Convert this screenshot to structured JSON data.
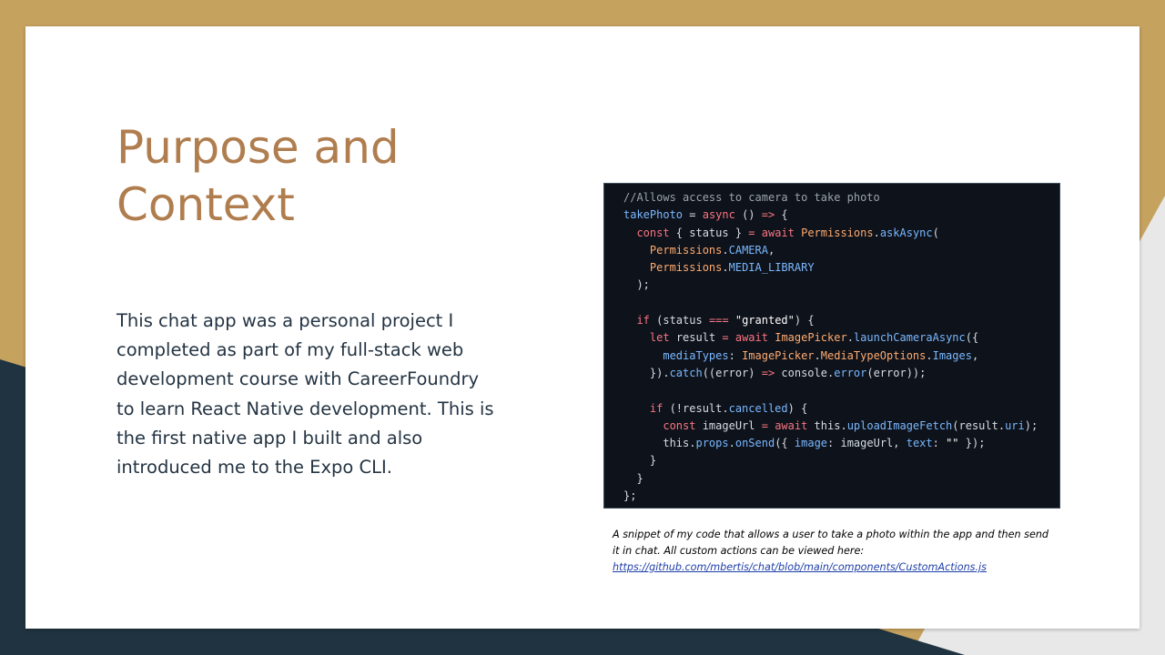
{
  "title_lines": [
    "Purpose and",
    "Context"
  ],
  "body": "This chat app was a personal project I completed as part of my full-stack web development course with CareerFoundry to learn React Native development. This is the first native app I built and also introduced me to the Expo CLI.",
  "code": {
    "lines": [
      [
        {
          "t": "//Allows access to camera to take photo",
          "c": "com"
        }
      ],
      [
        {
          "t": "takePhoto",
          "c": "fn"
        },
        {
          "t": " = ",
          "c": "plain"
        },
        {
          "t": "async",
          "c": "kw"
        },
        {
          "t": " () ",
          "c": "plain"
        },
        {
          "t": "=>",
          "c": "kw"
        },
        {
          "t": " {",
          "c": "plain"
        }
      ],
      [
        {
          "t": "  ",
          "c": "plain"
        },
        {
          "t": "const",
          "c": "kw"
        },
        {
          "t": " { status } ",
          "c": "plain"
        },
        {
          "t": "=",
          "c": "kw"
        },
        {
          "t": " ",
          "c": "plain"
        },
        {
          "t": "await",
          "c": "kw"
        },
        {
          "t": " ",
          "c": "plain"
        },
        {
          "t": "Permissions",
          "c": "cls"
        },
        {
          "t": ".",
          "c": "plain"
        },
        {
          "t": "askAsync",
          "c": "fn"
        },
        {
          "t": "(",
          "c": "plain"
        }
      ],
      [
        {
          "t": "    ",
          "c": "plain"
        },
        {
          "t": "Permissions",
          "c": "cls"
        },
        {
          "t": ".",
          "c": "plain"
        },
        {
          "t": "CAMERA",
          "c": "fn"
        },
        {
          "t": ",",
          "c": "plain"
        }
      ],
      [
        {
          "t": "    ",
          "c": "plain"
        },
        {
          "t": "Permissions",
          "c": "cls"
        },
        {
          "t": ".",
          "c": "plain"
        },
        {
          "t": "MEDIA_LIBRARY",
          "c": "fn"
        }
      ],
      [
        {
          "t": "  );",
          "c": "plain"
        }
      ],
      [],
      [
        {
          "t": "  ",
          "c": "plain"
        },
        {
          "t": "if",
          "c": "kw"
        },
        {
          "t": " (status ",
          "c": "plain"
        },
        {
          "t": "===",
          "c": "kw"
        },
        {
          "t": " ",
          "c": "plain"
        },
        {
          "t": "\"granted\"",
          "c": "str"
        },
        {
          "t": ") {",
          "c": "plain"
        }
      ],
      [
        {
          "t": "    ",
          "c": "plain"
        },
        {
          "t": "let",
          "c": "kw"
        },
        {
          "t": " result ",
          "c": "plain"
        },
        {
          "t": "=",
          "c": "kw"
        },
        {
          "t": " ",
          "c": "plain"
        },
        {
          "t": "await",
          "c": "kw"
        },
        {
          "t": " ",
          "c": "plain"
        },
        {
          "t": "ImagePicker",
          "c": "cls"
        },
        {
          "t": ".",
          "c": "plain"
        },
        {
          "t": "launchCameraAsync",
          "c": "fn"
        },
        {
          "t": "({",
          "c": "plain"
        }
      ],
      [
        {
          "t": "      ",
          "c": "plain"
        },
        {
          "t": "mediaTypes",
          "c": "fn"
        },
        {
          "t": ": ",
          "c": "plain"
        },
        {
          "t": "ImagePicker",
          "c": "cls"
        },
        {
          "t": ".",
          "c": "plain"
        },
        {
          "t": "MediaTypeOptions",
          "c": "cls"
        },
        {
          "t": ".",
          "c": "plain"
        },
        {
          "t": "Images",
          "c": "fn"
        },
        {
          "t": ",",
          "c": "plain"
        }
      ],
      [
        {
          "t": "    }).",
          "c": "plain"
        },
        {
          "t": "catch",
          "c": "fn"
        },
        {
          "t": "((error) ",
          "c": "plain"
        },
        {
          "t": "=>",
          "c": "kw"
        },
        {
          "t": " console.",
          "c": "plain"
        },
        {
          "t": "error",
          "c": "fn"
        },
        {
          "t": "(error));",
          "c": "plain"
        }
      ],
      [],
      [
        {
          "t": "    ",
          "c": "plain"
        },
        {
          "t": "if",
          "c": "kw"
        },
        {
          "t": " (!result.",
          "c": "plain"
        },
        {
          "t": "cancelled",
          "c": "fn"
        },
        {
          "t": ") {",
          "c": "plain"
        }
      ],
      [
        {
          "t": "      ",
          "c": "plain"
        },
        {
          "t": "const",
          "c": "kw"
        },
        {
          "t": " imageUrl ",
          "c": "plain"
        },
        {
          "t": "=",
          "c": "kw"
        },
        {
          "t": " ",
          "c": "plain"
        },
        {
          "t": "await",
          "c": "kw"
        },
        {
          "t": " this.",
          "c": "plain"
        },
        {
          "t": "uploadImageFetch",
          "c": "fn"
        },
        {
          "t": "(result.",
          "c": "plain"
        },
        {
          "t": "uri",
          "c": "fn"
        },
        {
          "t": ");",
          "c": "plain"
        }
      ],
      [
        {
          "t": "      this.",
          "c": "plain"
        },
        {
          "t": "props",
          "c": "fn"
        },
        {
          "t": ".",
          "c": "plain"
        },
        {
          "t": "onSend",
          "c": "fn"
        },
        {
          "t": "({ ",
          "c": "plain"
        },
        {
          "t": "image",
          "c": "fn"
        },
        {
          "t": ": imageUrl, ",
          "c": "plain"
        },
        {
          "t": "text",
          "c": "fn"
        },
        {
          "t": ": ",
          "c": "plain"
        },
        {
          "t": "\"\"",
          "c": "str"
        },
        {
          "t": " });",
          "c": "plain"
        }
      ],
      [
        {
          "t": "    }",
          "c": "plain"
        }
      ],
      [
        {
          "t": "  }",
          "c": "plain"
        }
      ],
      [
        {
          "t": "};",
          "c": "plain"
        }
      ]
    ]
  },
  "caption": {
    "text": "A snippet of my code that allows a user to take a photo within the app and then send it in chat. All custom actions can be viewed here:",
    "link_text": "https://github.com/mbertis/chat/blob/main/components/CustomActions.js"
  },
  "colors": {
    "accent_gold": "#c6a25f",
    "title_brown": "#b07d4e",
    "navy": "#1f3340",
    "code_bg": "#0e121a"
  }
}
